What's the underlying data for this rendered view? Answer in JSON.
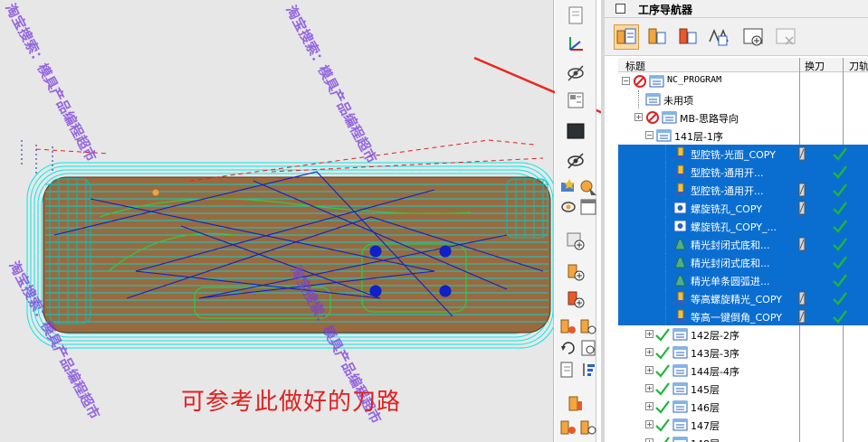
{
  "viewport": {
    "caption": "可参考此做好的刀路",
    "watermark": "淘宝搜索：模具产品编程超市"
  },
  "navigator": {
    "title": "工序导航器",
    "columns": {
      "name": "标题",
      "tool_change": "换刀",
      "path": "刀轨"
    },
    "rows": [
      {
        "label": "NC_PROGRAM",
        "mono": true
      },
      {
        "label": "未用项",
        "mono": false
      },
      {
        "label": "MB-思路导向",
        "mono": false
      },
      {
        "label": "141层-1序",
        "mono": false
      },
      {
        "label": "型腔铣-光面_COPY",
        "mono": false
      },
      {
        "label": "型腔铣-通用开...",
        "mono": false
      },
      {
        "label": "型腔铣-通用开...",
        "mono": false
      },
      {
        "label": "螺旋铣孔_COPY",
        "mono": false
      },
      {
        "label": "螺旋铣孔_COPY_...",
        "mono": false
      },
      {
        "label": "精光封闭式底和...",
        "mono": false
      },
      {
        "label": "精光封闭式底和...",
        "mono": false
      },
      {
        "label": "精光单条圆弧进...",
        "mono": false
      },
      {
        "label": "等高螺旋精光_COPY",
        "mono": false
      },
      {
        "label": "等高一键倒角_COPY",
        "mono": false
      },
      {
        "label": "142层-2序",
        "mono": false
      },
      {
        "label": "143层-3序",
        "mono": false
      },
      {
        "label": "144层-4序",
        "mono": false
      },
      {
        "label": "145层",
        "mono": false
      },
      {
        "label": "146层",
        "mono": false
      },
      {
        "label": "147层",
        "mono": false
      },
      {
        "label": "148层",
        "mono": false
      }
    ]
  },
  "colors": {
    "selection": "#0a6ed1",
    "check": "#1fb53a",
    "arrow": "#e8281e",
    "watermark": "#7a3cdc",
    "toolpath_cyan": "#00e5e5"
  }
}
